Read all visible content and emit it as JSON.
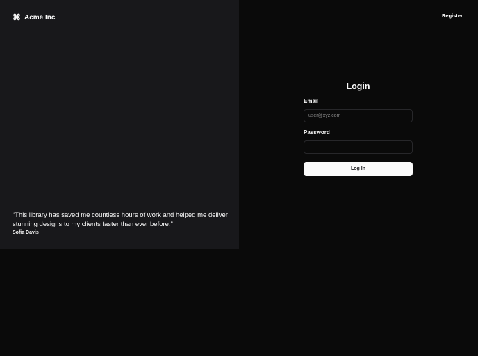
{
  "brand": {
    "name": "Acme Inc",
    "icon": "command-icon"
  },
  "nav": {
    "register": "Register"
  },
  "testimonial": {
    "quote": "“This library has saved me countless hours of work and helped me deliver stunning designs to my clients faster than ever before.”",
    "author": "Sofia Davis"
  },
  "login": {
    "title": "Login",
    "email_label": "Email",
    "email_placeholder": "user@xyz.com",
    "email_value": "",
    "password_label": "Password",
    "password_value": "",
    "submit": "Log In"
  }
}
